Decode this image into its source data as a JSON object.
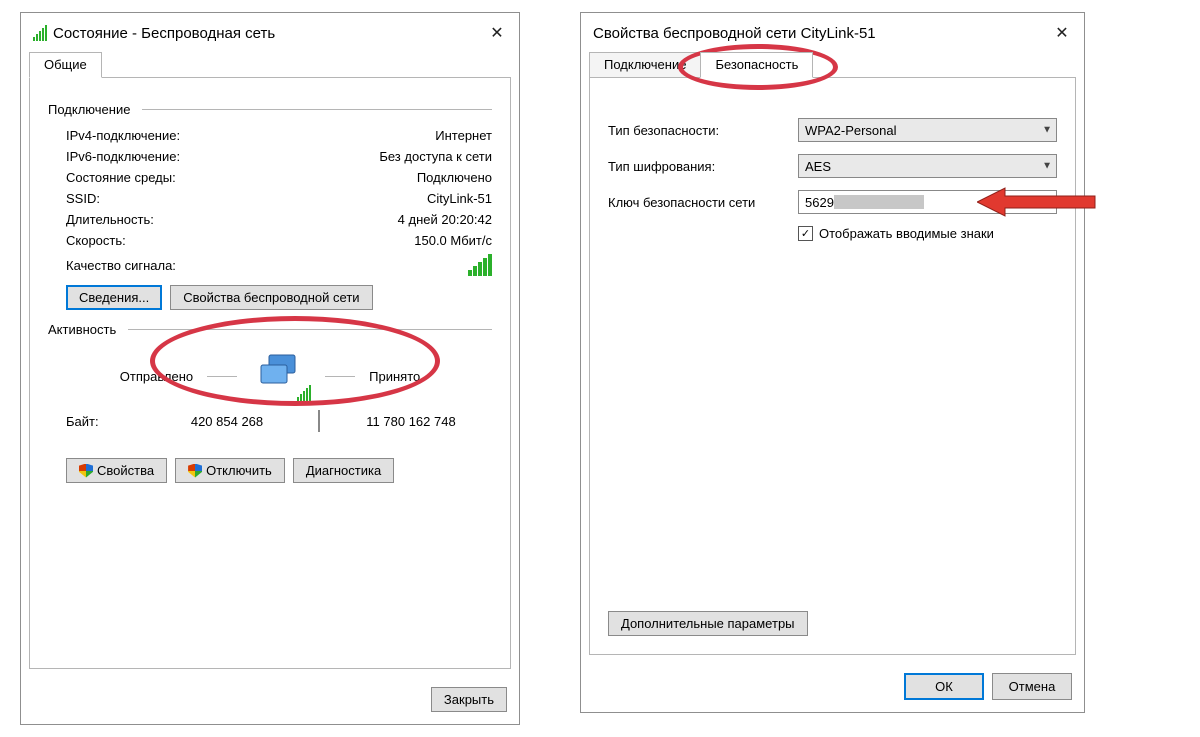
{
  "statusDialog": {
    "title": "Состояние - Беспроводная сеть",
    "tab": "Общие",
    "connectionGroup": "Подключение",
    "rows": {
      "ipv4_label": "IPv4-подключение:",
      "ipv4_value": "Интернет",
      "ipv6_label": "IPv6-подключение:",
      "ipv6_value": "Без доступа к сети",
      "media_label": "Состояние среды:",
      "media_value": "Подключено",
      "ssid_label": "SSID:",
      "ssid_value": "CityLink-51",
      "duration_label": "Длительность:",
      "duration_value": "4 дней 20:20:42",
      "speed_label": "Скорость:",
      "speed_value": "150.0 Мбит/с",
      "signal_label": "Качество сигнала:"
    },
    "buttons": {
      "details": "Сведения...",
      "wifi_props": "Свойства беспроводной сети"
    },
    "activityGroup": "Активность",
    "activity": {
      "sent_label": "Отправлено",
      "recv_label": "Принято",
      "bytes_label": "Байт:",
      "sent_value": "420 854 268",
      "recv_value": "11 780 162 748"
    },
    "bottomButtons": {
      "props": "Свойства",
      "disable": "Отключить",
      "diag": "Диагностика"
    },
    "close": "Закрыть"
  },
  "propsDialog": {
    "title": "Свойства беспроводной сети CityLink-51",
    "tabs": {
      "connection": "Подключение",
      "security": "Безопасность"
    },
    "fields": {
      "sec_type_label": "Тип безопасности:",
      "sec_type_value": "WPA2-Personal",
      "enc_label": "Тип шифрования:",
      "enc_value": "AES",
      "key_label": "Ключ безопасности сети",
      "key_value_visible": "5629",
      "show_chars": "Отображать вводимые знаки"
    },
    "advanced": "Дополнительные параметры",
    "ok": "ОК",
    "cancel": "Отмена"
  }
}
